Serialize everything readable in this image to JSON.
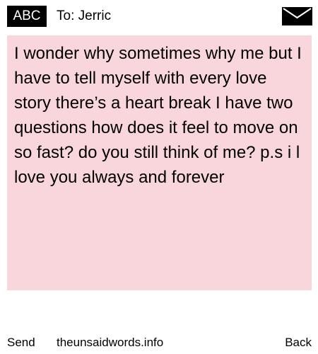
{
  "header": {
    "badge_label": "ABC",
    "to_label": "To:",
    "recipient": "Jerric",
    "envelope_icon": "envelope-icon"
  },
  "message": {
    "text": "I wonder why sometimes why me but I have to tell myself with every love story there’s a heart break I have two questions how does it feel to move on so fast? do you still think of me? p.s i l love you always and forever",
    "background_color": "#f9d6db"
  },
  "footer": {
    "send_label": "Send",
    "site_label": "theunsaidwords.info",
    "back_label": "Back"
  }
}
